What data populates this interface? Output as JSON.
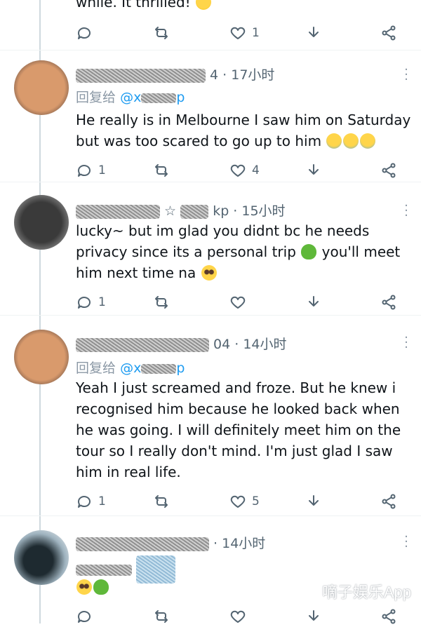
{
  "top_fragment": {
    "text": "while. It thrilled!",
    "emoji": "grinning-face-with-tongue",
    "likes": "1"
  },
  "tweets": [
    {
      "time": "4 · 17小时",
      "replying_label": "回复给",
      "replying_handle": "@x",
      "replying_tail": "p",
      "text_lines": [
        "He really is in Melbourne I saw him on Saturday",
        "but was too scared to go up to him"
      ],
      "emojis": [
        "loudly-crying-face",
        "loudly-crying-face",
        "loudly-crying-face"
      ],
      "replies": "1",
      "likes": "4"
    },
    {
      "time": "kp · 15小时",
      "text_lines": [
        "lucky~ but im glad you didnt bc he needs",
        "privacy since its a personal trip",
        "him next time na"
      ],
      "line2_tail": "you'll meet",
      "emojis": [
        "green-heart",
        "pleading-face"
      ],
      "replies": "1",
      "likes": ""
    },
    {
      "time": "04 · 14小时",
      "replying_label": "回复给",
      "replying_handle": "@x",
      "replying_tail": "p",
      "text_lines": [
        "Yeah I just screamed and froze. But he knew i",
        "recognised him because he looked back when",
        "he was going. I will  definitely meet him on the",
        "tour so I really don't mind. I'm just glad I saw",
        "him in real life."
      ],
      "replies": "1",
      "likes": "5"
    },
    {
      "time": "· 14小时",
      "emojis": [
        "pleading-face",
        "green-heart"
      ]
    }
  ],
  "watermark": "嘀子娱乐App",
  "colors": {
    "link": "#1d9bf0",
    "muted": "#536471",
    "divider": "#eff3f4"
  }
}
